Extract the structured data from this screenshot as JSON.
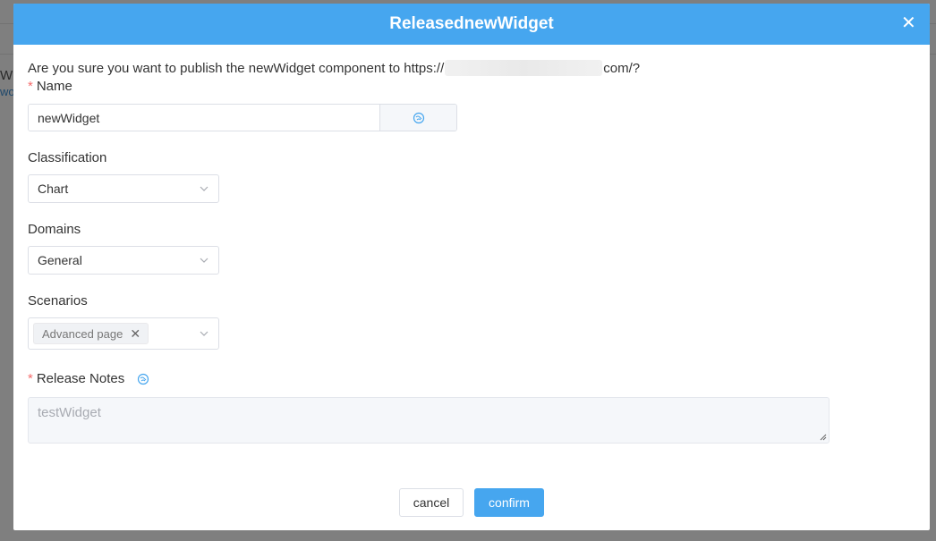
{
  "modal": {
    "title": "ReleasednewWidget",
    "confirm_prefix": "Are you sure you want to publish the newWidget component to https://",
    "confirm_suffix": "com/?"
  },
  "form": {
    "name": {
      "label": "Name",
      "value": "newWidget",
      "append_icon": "brain-icon"
    },
    "classification": {
      "label": "Classification",
      "selected": "Chart"
    },
    "domains": {
      "label": "Domains",
      "selected": "General"
    },
    "scenarios": {
      "label": "Scenarios",
      "tags": [
        "Advanced page"
      ]
    },
    "release_notes": {
      "label": "Release Notes",
      "placeholder": "testWidget",
      "icon": "brain-icon"
    }
  },
  "buttons": {
    "cancel": "cancel",
    "confirm": "confirm"
  },
  "colors": {
    "header": "#46a6ef",
    "primary_button": "#46a6ef",
    "required": "#f56c6c"
  }
}
